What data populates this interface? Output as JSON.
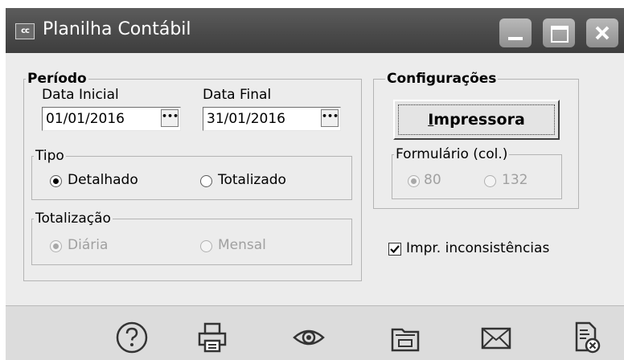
{
  "window": {
    "icon_text": "cc",
    "title": "Planilha Contábil"
  },
  "periodo": {
    "legend": "Período",
    "data_inicial": {
      "label": "Data Inicial",
      "value": "01/01/2016"
    },
    "data_final": {
      "label": "Data Final",
      "value": "31/01/2016"
    },
    "dots": "•••"
  },
  "tipo": {
    "legend": "Tipo",
    "options": [
      {
        "label": "Detalhado",
        "checked": true
      },
      {
        "label": "Totalizado",
        "checked": false
      }
    ]
  },
  "totalizacao": {
    "legend": "Totalização",
    "options": [
      {
        "label": "Diária",
        "checked": true,
        "disabled": true
      },
      {
        "label": "Mensal",
        "checked": false,
        "disabled": true
      }
    ]
  },
  "configuracoes": {
    "legend": "Configurações",
    "impressora_first": "I",
    "impressora_rest": "mpressora",
    "formulario": {
      "legend": "Formulário (col.)",
      "options": [
        {
          "label": "80",
          "checked": true,
          "disabled": true
        },
        {
          "label": "132",
          "checked": false,
          "disabled": true
        }
      ]
    }
  },
  "impr_inconsistencias": {
    "label": "Impr. inconsistências",
    "checked": true
  },
  "toolbar_icons": [
    "help-icon",
    "printer-icon",
    "preview-eye-icon",
    "folder-icon",
    "email-icon",
    "close-document-icon"
  ]
}
